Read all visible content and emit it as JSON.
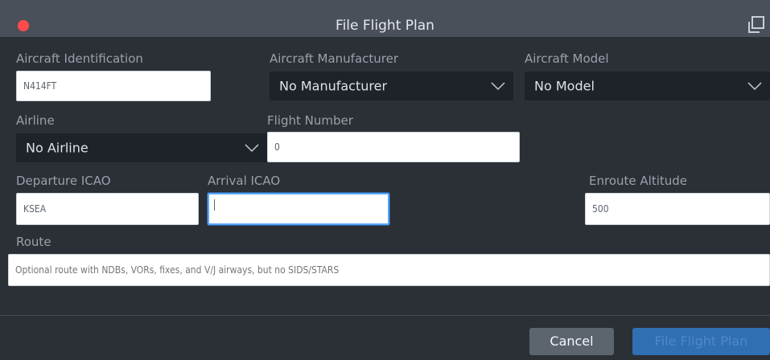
{
  "window": {
    "title": "File Flight Plan",
    "close_color": "#ff4b4b"
  },
  "form": {
    "aircraft_identification": {
      "label": "Aircraft Identification",
      "value": "N414FT"
    },
    "aircraft_manufacturer": {
      "label": "Aircraft Manufacturer",
      "selected": "No Manufacturer"
    },
    "aircraft_model": {
      "label": "Aircraft Model",
      "selected": "No Model"
    },
    "airline": {
      "label": "Airline",
      "selected": "No Airline"
    },
    "flight_number": {
      "label": "Flight Number",
      "value": "0"
    },
    "departure_icao": {
      "label": "Departure ICAO",
      "value": "KSEA"
    },
    "arrival_icao": {
      "label": "Arrival ICAO",
      "value": ""
    },
    "enroute_altitude": {
      "label": "Enroute Altitude",
      "value": "500"
    },
    "route": {
      "label": "Route",
      "placeholder": "Optional route with NDBs, VORs, fixes, and V/J airways, but no SIDS/STARS"
    }
  },
  "buttons": {
    "cancel": "Cancel",
    "file": "File Flight Plan"
  },
  "icons": {
    "popout": "popout-window-icon",
    "chevron": "chevron-down-icon",
    "close": "close-dot-icon"
  },
  "colors": {
    "accent": "#2f6fb2",
    "focus": "#58a6ff"
  }
}
